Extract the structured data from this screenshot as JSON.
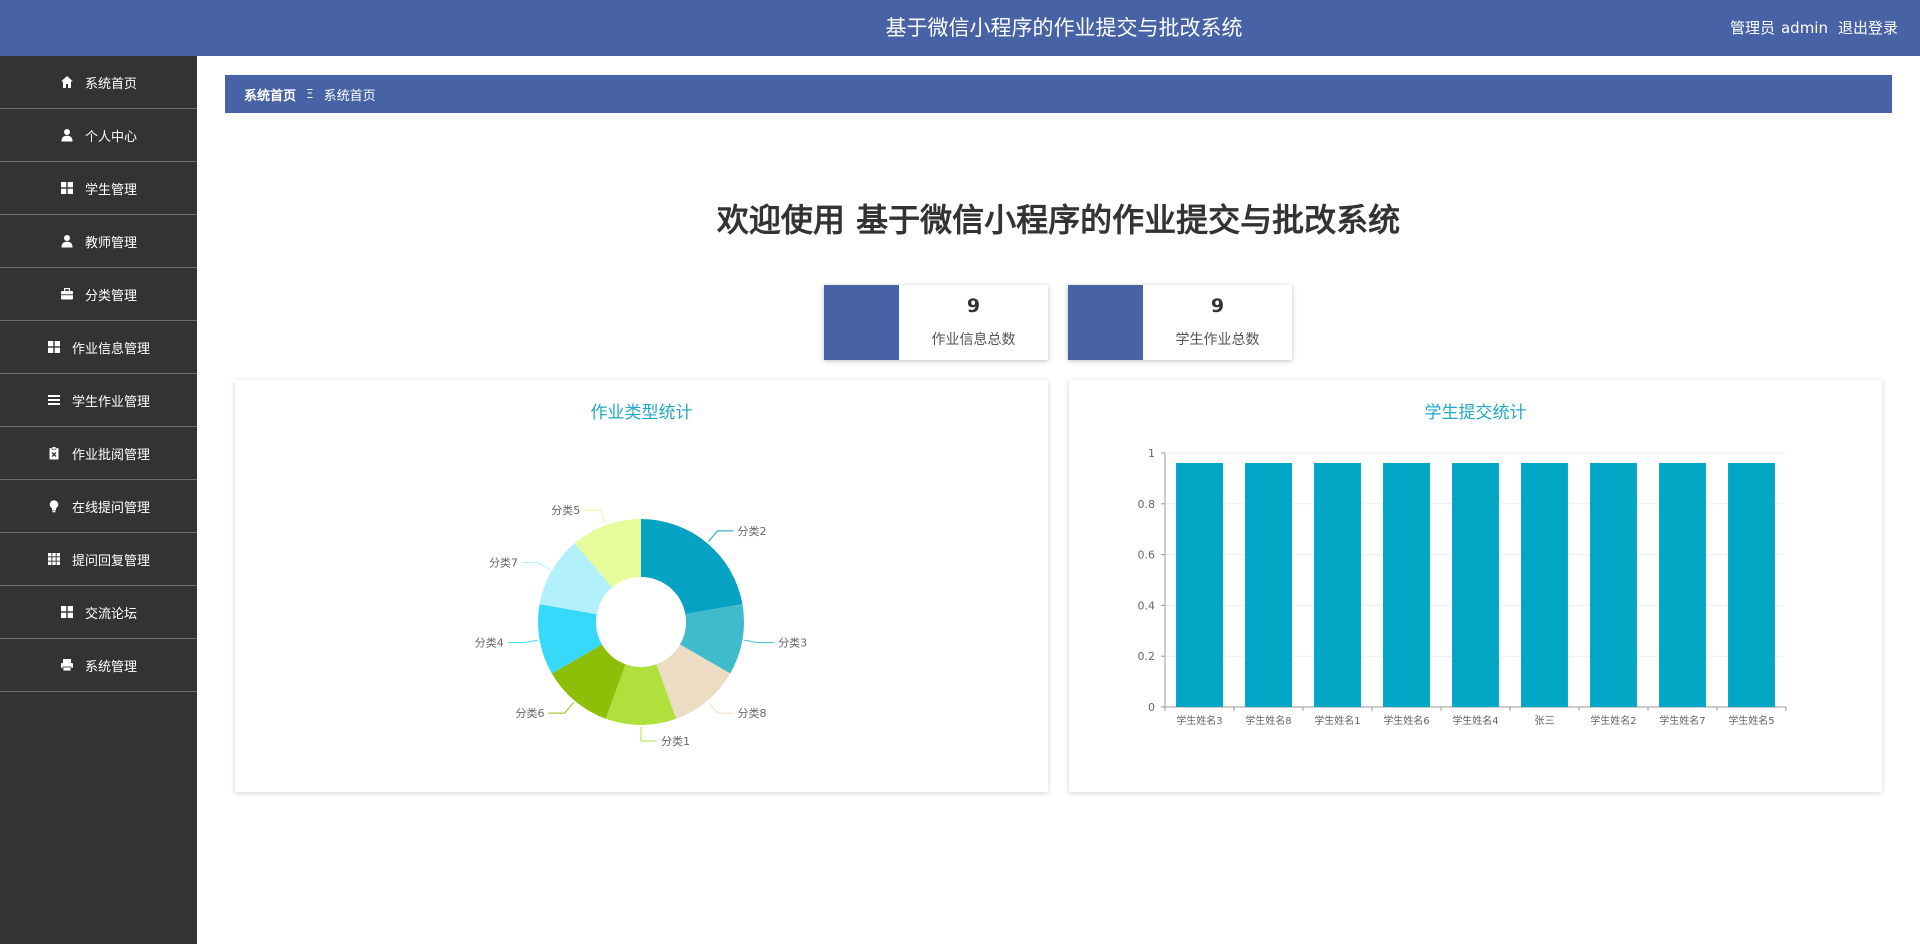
{
  "header": {
    "title": "基于微信小程序的作业提交与批改系统",
    "role": "管理员",
    "username": "admin",
    "logout": "退出登录"
  },
  "sidebar": {
    "items": [
      {
        "label": "系统首页",
        "icon": "home-icon"
      },
      {
        "label": "个人中心",
        "icon": "user-icon"
      },
      {
        "label": "学生管理",
        "icon": "grid-icon"
      },
      {
        "label": "教师管理",
        "icon": "user-icon"
      },
      {
        "label": "分类管理",
        "icon": "briefcase-icon"
      },
      {
        "label": "作业信息管理",
        "icon": "grid-icon"
      },
      {
        "label": "学生作业管理",
        "icon": "list-icon"
      },
      {
        "label": "作业批阅管理",
        "icon": "clipboard-icon"
      },
      {
        "label": "在线提问管理",
        "icon": "lightbulb-icon"
      },
      {
        "label": "提问回复管理",
        "icon": "table-icon"
      },
      {
        "label": "交流论坛",
        "icon": "grid-icon"
      },
      {
        "label": "系统管理",
        "icon": "printer-icon"
      }
    ]
  },
  "breadcrumb": {
    "home": "系统首页",
    "separator": "Ξ",
    "current": "系统首页"
  },
  "welcome": "欢迎使用 基于微信小程序的作业提交与批改系统",
  "stats": [
    {
      "value": "9",
      "label": "作业信息总数"
    },
    {
      "value": "9",
      "label": "学生作业总数"
    }
  ],
  "colors": {
    "primary": "#4763a5",
    "sidebar": "#333333",
    "accent_title": "#22a8c4",
    "bar": "#02a7c5"
  },
  "chart_data": [
    {
      "type": "pie",
      "title": "作业类型统计",
      "donut": true,
      "slices": [
        {
          "label": "分类2",
          "value": 2,
          "color": "#06a2c4"
        },
        {
          "label": "分类3",
          "value": 1,
          "color": "#3fbccb"
        },
        {
          "label": "分类8",
          "value": 1,
          "color": "#ecdcc4"
        },
        {
          "label": "分类1",
          "value": 1,
          "color": "#afe03c"
        },
        {
          "label": "分类6",
          "value": 1,
          "color": "#8dbf09"
        },
        {
          "label": "分类4",
          "value": 1,
          "color": "#37d9fb"
        },
        {
          "label": "分类7",
          "value": 1,
          "color": "#b2f1fb"
        },
        {
          "label": "分类5",
          "value": 1,
          "color": "#e6fc9a"
        }
      ]
    },
    {
      "type": "bar",
      "title": "学生提交统计",
      "categories": [
        "学生姓名3",
        "学生姓名8",
        "学生姓名1",
        "学生姓名6",
        "学生姓名4",
        "张三",
        "学生姓名2",
        "学生姓名7",
        "学生姓名5"
      ],
      "values": [
        1,
        1,
        1,
        1,
        1,
        1,
        1,
        1,
        1
      ],
      "yticks": [
        "0",
        "0.2",
        "0.4",
        "0.6",
        "0.8",
        "1"
      ],
      "ylim": [
        0,
        1
      ],
      "grid": true,
      "bar_color": "#02a7c5"
    }
  ]
}
